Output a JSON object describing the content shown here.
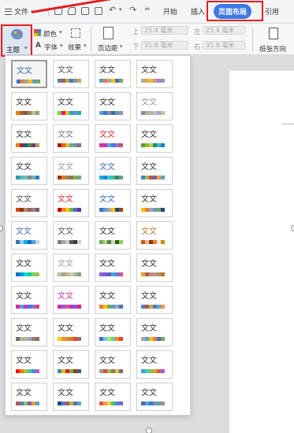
{
  "topbar": {
    "menu_label": "文件",
    "tabs": [
      {
        "label": "开始",
        "active": false
      },
      {
        "label": "插入",
        "active": false
      },
      {
        "label": "页面布局",
        "active": true
      },
      {
        "label": "引用",
        "active": false
      }
    ]
  },
  "ribbon": {
    "theme_label": "主题",
    "color_label": "颜色",
    "font_label": "字体",
    "effect_label": "效果",
    "margin_label": "页边距",
    "orientation_label": "纸张方向",
    "margin_top": "25.4 毫米",
    "margin_bottom": "31.8 毫米",
    "margin_left": "25.4 毫米",
    "margin_right": "31.8 毫米",
    "margin_top_prefix": "上",
    "margin_bottom_prefix": "下",
    "margin_left_prefix": "左",
    "margin_right_prefix": "右"
  },
  "theme_panel": {
    "sample_text": "文文",
    "themes": [
      {
        "text_color": "#3f6fb5",
        "swatches": [
          "#4472c4",
          "#ed7d31",
          "#a5a5a5",
          "#ffc000",
          "#5b9bd5",
          "#70ad47"
        ]
      },
      {
        "text_color": "#555555",
        "swatches": [
          "#4f81bd",
          "#c0504d",
          "#9bbb59",
          "#8064a2",
          "#4bacc6",
          "#f79646"
        ]
      },
      {
        "text_color": "#333333",
        "swatches": [
          "#5b9bd5",
          "#ed7d31",
          "#a5a5a5",
          "#ffc000",
          "#4472c4",
          "#70ad47"
        ]
      },
      {
        "text_color": "#333333",
        "swatches": [
          "#a5b592",
          "#f3a447",
          "#e7bc29",
          "#d092a7",
          "#9c85c0",
          "#809ec2"
        ]
      },
      {
        "text_color": "#333333",
        "swatches": [
          "#e48312",
          "#bd582c",
          "#865640",
          "#9b8357",
          "#c2bc80",
          "#94a088"
        ]
      },
      {
        "text_color": "#333333",
        "swatches": [
          "#7fd13b",
          "#ea157a",
          "#feb80a",
          "#00addc",
          "#738ac8",
          "#1ab39f"
        ]
      },
      {
        "text_color": "#333333",
        "swatches": [
          "#629dd1",
          "#297fd5",
          "#7f8fa9",
          "#4a66ac",
          "#5aa2ae",
          "#9d90a0"
        ]
      },
      {
        "text_color": "#9a9aa8",
        "swatches": [
          "#8784c7",
          "#a5b592",
          "#cda3a6",
          "#9fcbc5",
          "#a0ace0",
          "#d3b98b"
        ]
      },
      {
        "text_color": "#333333",
        "swatches": [
          "#f07f09",
          "#9f2936",
          "#1b587c",
          "#4e8542",
          "#604878",
          "#c19859"
        ]
      },
      {
        "text_color": "#777777",
        "swatches": [
          "#b01513",
          "#ea6312",
          "#e6b729",
          "#6aac90",
          "#5f9c9d",
          "#9e5e9b"
        ]
      },
      {
        "text_color": "#d9302c",
        "swatches": [
          "#e32d91",
          "#c830cc",
          "#4ea6dc",
          "#4775e7",
          "#8971e1",
          "#d54773"
        ]
      },
      {
        "text_color": "#333333",
        "swatches": [
          "#549e39",
          "#8ab833",
          "#c0cf3a",
          "#029676",
          "#4ab5c4",
          "#0989b1"
        ]
      },
      {
        "text_color": "#333333",
        "swatches": [
          "#3494ba",
          "#58b6c0",
          "#75bda7",
          "#7a8c8e",
          "#84acb6",
          "#2683c6"
        ]
      },
      {
        "text_color": "#9a9a9a",
        "swatches": [
          "#a53010",
          "#de7e18",
          "#9f8351",
          "#728653",
          "#92aa4c",
          "#6aac91"
        ]
      },
      {
        "text_color": "#3f6fb5",
        "swatches": [
          "#1cade4",
          "#2683c6",
          "#27ced7",
          "#42ba97",
          "#3e8853",
          "#62a39f"
        ]
      },
      {
        "text_color": "#333333",
        "swatches": [
          "#4f81bd",
          "#9bbb59",
          "#c0504d",
          "#8064a2",
          "#f79646",
          "#4bacc6"
        ]
      },
      {
        "text_color": "#555555",
        "swatches": [
          "#d34817",
          "#9b2d1f",
          "#a28e6a",
          "#956251",
          "#918485",
          "#855d5d"
        ]
      },
      {
        "text_color": "#d9302c",
        "swatches": [
          "#c00000",
          "#ed7d31",
          "#ffc000",
          "#70ad47",
          "#4472c4",
          "#7030a0"
        ]
      },
      {
        "text_color": "#3f6fb5",
        "swatches": [
          "#4472c4",
          "#5b9bd5",
          "#a5a5a5",
          "#ffc000",
          "#264478",
          "#9e480e"
        ]
      },
      {
        "text_color": "#333333",
        "swatches": [
          "#ffc000",
          "#ed7d31",
          "#a5a5a5",
          "#5b9bd5",
          "#70ad47",
          "#264478"
        ]
      },
      {
        "text_color": "#3f6fb5",
        "swatches": [
          "#2e75b6",
          "#9dc3e6",
          "#00b0f0",
          "#0070c0",
          "#5b9bd5",
          "#bdd7ee"
        ]
      },
      {
        "text_color": "#555555",
        "swatches": [
          "#7f7f7f",
          "#a5a5a5",
          "#c9c9c9",
          "#595959",
          "#3a3a3a",
          "#d0cece"
        ]
      },
      {
        "text_color": "#333333",
        "swatches": [
          "#70ad47",
          "#a9d18e",
          "#548235",
          "#c5e0b4",
          "#375623",
          "#92d050"
        ]
      },
      {
        "text_color": "#b7792b",
        "swatches": [
          "#c55a11",
          "#f4b183",
          "#843c0c",
          "#ed7d31",
          "#fbe5d6",
          "#bf9000"
        ]
      },
      {
        "text_color": "#333333",
        "swatches": [
          "#0f6fc6",
          "#009dd9",
          "#0bd0d9",
          "#10cf9b",
          "#7cca62",
          "#a5c249"
        ]
      },
      {
        "text_color": "#9a9a9a",
        "swatches": [
          "#b8c3a0",
          "#9aab8c",
          "#c6b28a",
          "#d9c9a0",
          "#a3b7ad",
          "#8c9c7e"
        ]
      },
      {
        "text_color": "#333333",
        "swatches": [
          "#9b57d3",
          "#755dd9",
          "#665eb8",
          "#45a5ed",
          "#5982db",
          "#e84c8b"
        ]
      },
      {
        "text_color": "#333333",
        "swatches": [
          "#f0a22e",
          "#a5644e",
          "#b58b80",
          "#c3986d",
          "#a19574",
          "#c17529"
        ]
      },
      {
        "text_color": "#333333",
        "swatches": [
          "#e32d91",
          "#4ea6dc",
          "#c830cc",
          "#4775e7",
          "#8971e1",
          "#d54773"
        ]
      },
      {
        "text_color": "#d02f9d",
        "swatches": [
          "#d02f9d",
          "#9b57d3",
          "#e84c8b",
          "#c830cc",
          "#755dd9",
          "#ea157a"
        ]
      },
      {
        "text_color": "#333333",
        "swatches": [
          "#ed7d31",
          "#ffc000",
          "#70ad47",
          "#5b9bd5",
          "#a5a5a5",
          "#4472c4"
        ]
      },
      {
        "text_color": "#333333",
        "swatches": [
          "#4f81bd",
          "#c0504d",
          "#9bbb59",
          "#8064a2",
          "#4bacc6",
          "#f79646"
        ]
      },
      {
        "text_color": "#333333",
        "swatches": [
          "#6f6f74",
          "#a7b789",
          "#beae98",
          "#92a9b9",
          "#9c8265",
          "#8d6974"
        ]
      },
      {
        "text_color": "#333333",
        "swatches": [
          "#ffca08",
          "#f8931d",
          "#ce8d3e",
          "#ec7016",
          "#e64823",
          "#9c6a6a"
        ]
      },
      {
        "text_color": "#333333",
        "swatches": [
          "#4e67c8",
          "#5eccf3",
          "#a7ea52",
          "#5dceaf",
          "#ff8021",
          "#f14124"
        ]
      },
      {
        "text_color": "#333333",
        "swatches": [
          "#a5a5a5",
          "#5b9bd5",
          "#ffc000",
          "#ed7d31",
          "#4472c4",
          "#70ad47"
        ]
      },
      {
        "text_color": "#333333",
        "swatches": [
          "#f81b02",
          "#fc7715",
          "#afbf41",
          "#50c49f",
          "#3b95c4",
          "#b560d4"
        ]
      },
      {
        "text_color": "#333333",
        "swatches": [
          "#3891a7",
          "#feb80a",
          "#c32d2e",
          "#84aa33",
          "#964305",
          "#475a8d"
        ]
      },
      {
        "text_color": "#333333",
        "swatches": [
          "#93a299",
          "#cf543f",
          "#b5ae53",
          "#848058",
          "#e8b54d",
          "#786c71"
        ]
      },
      {
        "text_color": "#333333",
        "swatches": [
          "#2fa3ee",
          "#4bcaad",
          "#86c157",
          "#d99c3f",
          "#ce6633",
          "#a35dd1"
        ]
      },
      {
        "text_color": "#333333",
        "swatches": [
          "#c0504d",
          "#4f81bd",
          "#9bbb59",
          "#8064a2",
          "#f79646",
          "#4bacc6"
        ]
      },
      {
        "text_color": "#333333",
        "swatches": [
          "#1f497d",
          "#4f81bd",
          "#c0504d",
          "#9bbb59",
          "#8064a2",
          "#4bacc6"
        ]
      },
      {
        "text_color": "#333333",
        "swatches": [
          "#f24f4f",
          "#f2a13b",
          "#e0d14c",
          "#5cb85c",
          "#3f8fd2",
          "#8e5cc9"
        ]
      },
      {
        "text_color": "#333333",
        "swatches": [
          "#4a66ac",
          "#629dd1",
          "#297fd5",
          "#7f8fa9",
          "#5aa2ae",
          "#9d90a0"
        ]
      }
    ]
  }
}
